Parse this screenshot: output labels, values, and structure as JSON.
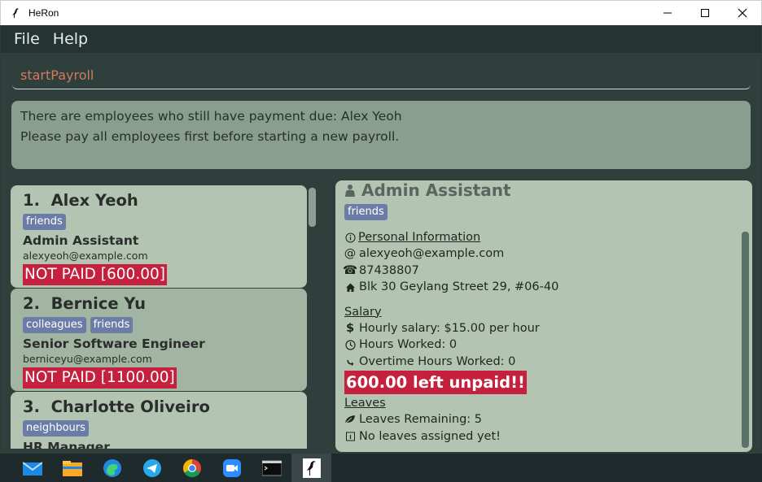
{
  "window": {
    "title": "HeRon"
  },
  "menu": {
    "file": "File",
    "help": "Help"
  },
  "command": {
    "value": "startPayroll"
  },
  "result": {
    "line1": "There are employees who still have payment due: Alex Yeoh",
    "line2": "Please pay all employees first before starting a new payroll."
  },
  "employees": [
    {
      "index": "1.",
      "name": "Alex Yeoh",
      "tags": [
        "friends"
      ],
      "role": "Admin Assistant",
      "email": "alexyeoh@example.com",
      "due": "NOT PAID [600.00]"
    },
    {
      "index": "2.",
      "name": "Bernice Yu",
      "tags": [
        "colleagues",
        "friends"
      ],
      "role": "Senior Software Engineer",
      "email": "berniceyu@example.com",
      "due": "NOT PAID [1100.00]"
    },
    {
      "index": "3.",
      "name": "Charlotte Oliveiro",
      "tags": [
        "neighbours"
      ],
      "role": "HR Manager",
      "email": "",
      "due": ""
    }
  ],
  "detail": {
    "role": "Admin Assistant",
    "tag": "friends",
    "personal_header": "Personal Information",
    "email": "alexyeoh@example.com",
    "phone": "87438807",
    "address": "Blk 30 Geylang Street 29, #06-40",
    "salary_header": "Salary",
    "hourly": "Hourly salary: $15.00 per hour",
    "hours": "Hours Worked: 0",
    "overtime": "Overtime Hours Worked: 0",
    "unpaid": "600.00 left unpaid!!",
    "leaves_header": "Leaves",
    "leaves_remaining": "Leaves Remaining: 5",
    "leaves_assigned": "No leaves assigned yet!"
  },
  "taskbar": [
    "mail-icon",
    "file-explorer-icon",
    "edge-icon",
    "telegram-icon",
    "chrome-icon",
    "zoom-icon",
    "terminal-icon",
    "heron-icon"
  ],
  "colors": {
    "unpaid": "#c5203e",
    "tag": "#6b7da6",
    "card": "#b3c4b3",
    "background": "#2f3f3c"
  }
}
